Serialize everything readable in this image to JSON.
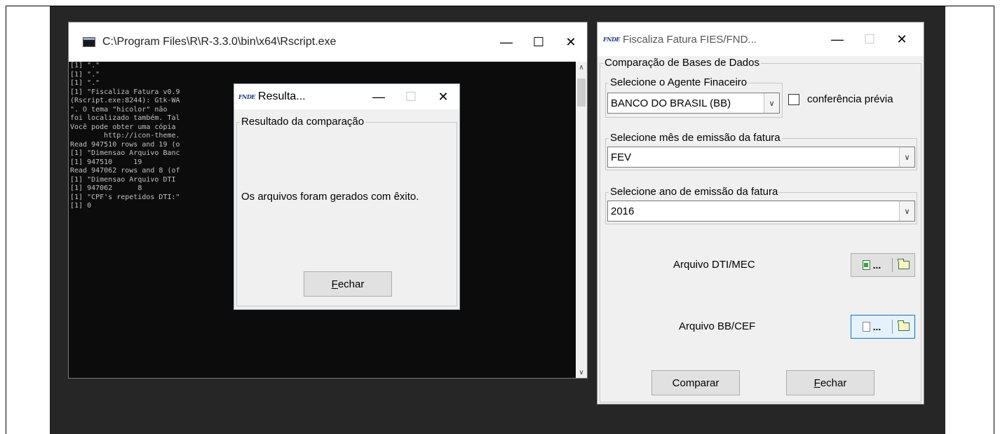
{
  "console_window": {
    "title": "C:\\Program Files\\R\\R-3.3.0\\bin\\x64\\Rscript.exe",
    "minimize": "—",
    "maximize": "☐",
    "close": "✕",
    "lines": [
      "[1] \".\"",
      "[1] \".\"",
      "[1] \".\"",
      "[1] \"Fiscaliza Fatura v0.9",
      "",
      "(Rscript.exe:8244): Gtk-WA                                    o ícone \"gtk-file",
      "\". O tema \"hicolor\" não",
      "foi localizado também. Tal",
      "Você pode obter uma cópia",
      "        http://icon-theme.",
      "Read 947510 rows and 19 (o                                 00:00:17",
      "[1] \"Dimensao Arquivo Banc",
      "[1] 947510     19",
      "Read 947062 rows and 8 (of                                 :00:03",
      "[1] \"Dimensao Arquivo DTI",
      "[1] 947062      8",
      "[1] \"CPF's repetidos DTI:\"",
      "[1] 0"
    ]
  },
  "result_dialog": {
    "title": "Resulta...",
    "icon_text": "FNDE",
    "minimize": "—",
    "maximize": "☐",
    "close": "✕",
    "group_label": "Resultado da comparação",
    "message": "Os arquivos foram gerados com êxito.",
    "close_button_first": "F",
    "close_button_rest": "echar"
  },
  "app_window": {
    "title": "Fiscaliza Fatura FIES/FND...",
    "icon_text": "FNDE",
    "minimize": "—",
    "maximize": "☐",
    "close": "✕",
    "main_group_label": "Comparação de Bases de Dados",
    "agent_group_label": "Selecione o Agente Finaceiro",
    "agent_value": "BANCO DO BRASIL (BB)",
    "pre_check_label": "conferência prévia",
    "month_group_label": "Selecione mês de emissão da fatura",
    "month_value": "FEV",
    "year_group_label": "Selecione ano de emissão da fatura",
    "year_value": "2016",
    "file1_label": "Arquivo DTI/MEC",
    "file2_label": "Arquivo BB/CEF",
    "file_button_text": "...",
    "compare_button": "Comparar",
    "close_button_first": "F",
    "close_button_rest": "echar",
    "dropdown_arrow": "∨"
  }
}
